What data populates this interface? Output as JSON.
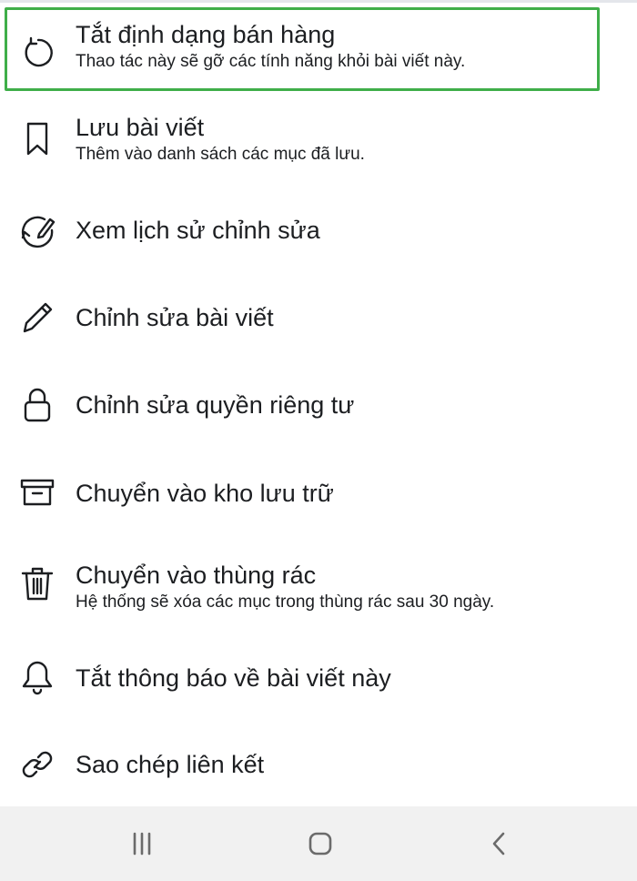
{
  "menu": {
    "items": [
      {
        "title": "Tắt định dạng bán hàng",
        "subtitle": "Thao tác này sẽ gỡ các tính năng khỏi bài viết này.",
        "icon": "refresh-icon"
      },
      {
        "title": "Lưu bài viết",
        "subtitle": "Thêm vào danh sách các mục đã lưu.",
        "icon": "bookmark-icon"
      },
      {
        "title": "Xem lịch sử chỉnh sửa",
        "icon": "edit-history-icon"
      },
      {
        "title": "Chỉnh sửa bài viết",
        "icon": "pencil-icon"
      },
      {
        "title": "Chỉnh sửa quyền riêng tư",
        "icon": "lock-icon"
      },
      {
        "title": "Chuyển vào kho lưu trữ",
        "icon": "archive-icon"
      },
      {
        "title": "Chuyển vào thùng rác",
        "subtitle": "Hệ thống sẽ xóa các mục trong thùng rác sau 30 ngày.",
        "icon": "trash-icon"
      },
      {
        "title": "Tắt thông báo về bài viết này",
        "icon": "bell-icon"
      },
      {
        "title": "Sao chép liên kết",
        "icon": "link-icon"
      }
    ]
  },
  "highlight_color": "#3fae49",
  "navbar": {
    "buttons": [
      "recent-apps-icon",
      "home-icon",
      "back-icon"
    ]
  }
}
